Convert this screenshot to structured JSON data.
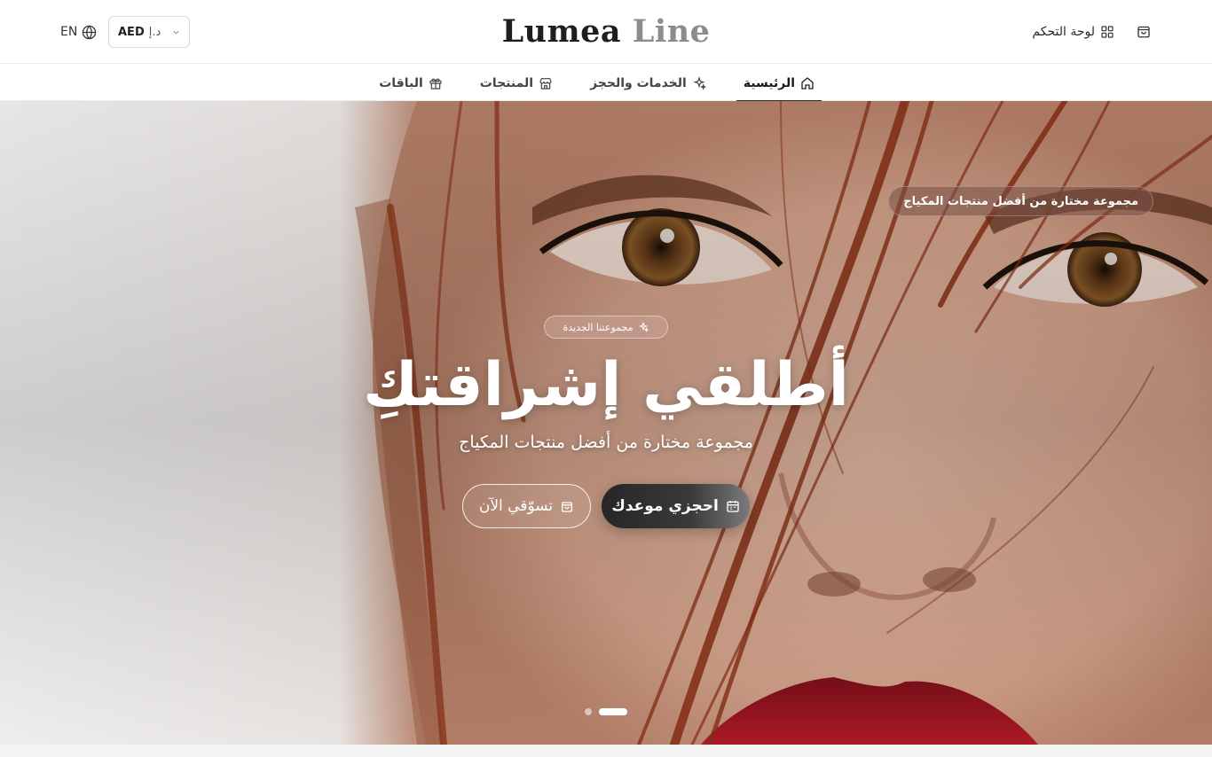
{
  "header": {
    "lang_label": "EN",
    "currency": {
      "code": "AED",
      "symbol": "د.إ"
    },
    "logo": {
      "word1": "Lumea",
      "word2": "Line"
    },
    "dashboard_label": "لوحة التحكم"
  },
  "nav": {
    "items": [
      {
        "label": "الرئيسية",
        "icon": "home-icon",
        "active": true
      },
      {
        "label": "الخدمات والحجز",
        "icon": "sparkles-icon",
        "active": false
      },
      {
        "label": "المنتجات",
        "icon": "store-icon",
        "active": false
      },
      {
        "label": "الباقات",
        "icon": "gift-icon",
        "active": false
      }
    ]
  },
  "hero": {
    "badge_top": "مجموعة مختارة من أفضل منتجات المكياج",
    "pill_new": "مجموعتنا الجديدة",
    "headline": "أطلقي إشراقتكِ",
    "subline": "مجموعة مختارة من أفضل منتجات المكياج",
    "book_label": "احجزي موعدك",
    "shop_label": "تسوّقي الآن",
    "slides_total": 2,
    "slide_active": 1
  },
  "colors": {
    "primary_dark": "#262626",
    "accent_lip": "#9c1420",
    "hair": "#8a2f14"
  }
}
